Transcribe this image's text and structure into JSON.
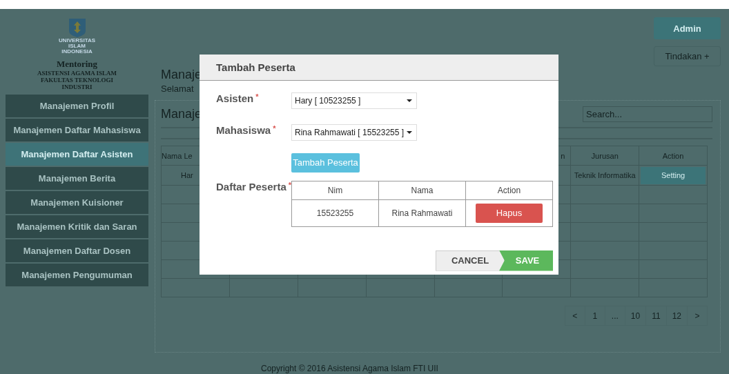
{
  "sidebar": {
    "logo_lines": [
      "UNIVERSITAS",
      "ISLAM",
      "INDONESIA"
    ],
    "title_lines": [
      "Mentoring",
      "ASISTENSI AGAMA ISLAM",
      "FAKULTAS TEKNOLOGI",
      "INDUSTRI"
    ],
    "items": [
      {
        "label": "Manajemen Profil",
        "selected": false
      },
      {
        "label": "Manajemen Daftar Mahasiswa",
        "selected": false
      },
      {
        "label": "Manajemen Daftar Asisten",
        "selected": true
      },
      {
        "label": "Manajemen Berita",
        "selected": false
      },
      {
        "label": "Manajemen Kuisioner",
        "selected": false
      },
      {
        "label": "Manajemen Kritik dan Saran",
        "selected": false
      },
      {
        "label": "Manajemen Daftar Dosen",
        "selected": false
      },
      {
        "label": "Manajemen Pengumuman",
        "selected": false
      }
    ]
  },
  "header": {
    "title": "Manaje",
    "subtitle": "Selamat",
    "user_button": "Admin",
    "actions_button": "Tindakan +"
  },
  "panel": {
    "title": "Manaje",
    "search": {
      "placeholder": "Search..."
    },
    "table": {
      "columns": [
        {
          "label": "Nama Le"
        },
        {},
        {},
        {},
        {},
        {
          "label": "n"
        },
        {
          "label": "Jurusan"
        },
        {
          "label": "Action"
        }
      ],
      "rows": [
        {
          "cells": [
            {
              "kind": "text",
              "text": "Har"
            },
            {},
            {},
            {},
            {},
            {},
            {
              "kind": "text",
              "text": "Teknik Informatika"
            },
            {
              "kind": "button",
              "text": "Setting"
            }
          ]
        }
      ]
    },
    "pagination": [
      "<",
      "1",
      "...",
      "10",
      "11",
      "12",
      ">"
    ]
  },
  "footer": "Copyright © 2016 Asistensi Agama Islam FTI UII",
  "modal": {
    "title": "Tambah Peserta",
    "fields": [
      {
        "label": "Asisten",
        "required_mark": "*",
        "value": "Hary [ 10523255 ]"
      },
      {
        "label": "Mahasiswa",
        "required_mark": "*",
        "value": "Rina Rahmawati [ 15523255 ]"
      }
    ],
    "add_button": "Tambah Peserta",
    "list": {
      "label": "Daftar Peserta",
      "required_mark": "*",
      "columns": [
        "Nim",
        "Nama",
        "Action"
      ],
      "rows": [
        {
          "nim": "15523255",
          "nama": "Rina Rahmawati",
          "action": "Hapus"
        }
      ]
    },
    "cancel_button": "CANCEL",
    "save_button": "SAVE"
  }
}
